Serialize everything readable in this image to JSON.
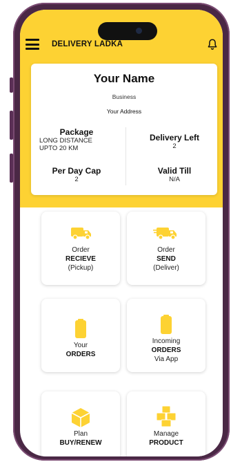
{
  "app": {
    "title": "DELIVERY LADKA"
  },
  "colors": {
    "accent": "#fdd233",
    "frame": "#4a2845"
  },
  "profile": {
    "name": "Your Name",
    "business": "Business",
    "address": "Your Address",
    "package_label": "Package",
    "package_value_1": "LONG DISTANCE",
    "package_value_2": "UPTO 20 KM",
    "delivery_left_label": "Delivery Left",
    "delivery_left_value": "2",
    "per_day_cap_label": "Per Day Cap",
    "per_day_cap_value": "2",
    "valid_till_label": "Valid Till",
    "valid_till_value": "N/A"
  },
  "tiles": {
    "order_receive": {
      "icon": "truck-icon",
      "line1": "Order",
      "line2": "RECIEVE",
      "line3": "(Pickup)"
    },
    "order_send": {
      "icon": "truck-icon",
      "line1": "Order",
      "line2": "SEND",
      "line3": "(Deliver)"
    },
    "your_orders": {
      "icon": "parcel-icon",
      "line1": "Your",
      "line2": "ORDERS"
    },
    "incoming_orders": {
      "icon": "parcel-icon",
      "line1": "Incoming",
      "line2": "ORDERS",
      "line3": "Via App"
    },
    "plan": {
      "icon": "box-icon",
      "line1": "Plan",
      "line2": "BUY/RENEW"
    },
    "manage_product": {
      "icon": "boxes-icon",
      "line1": "Manage",
      "line2": "PRODUCT"
    }
  }
}
